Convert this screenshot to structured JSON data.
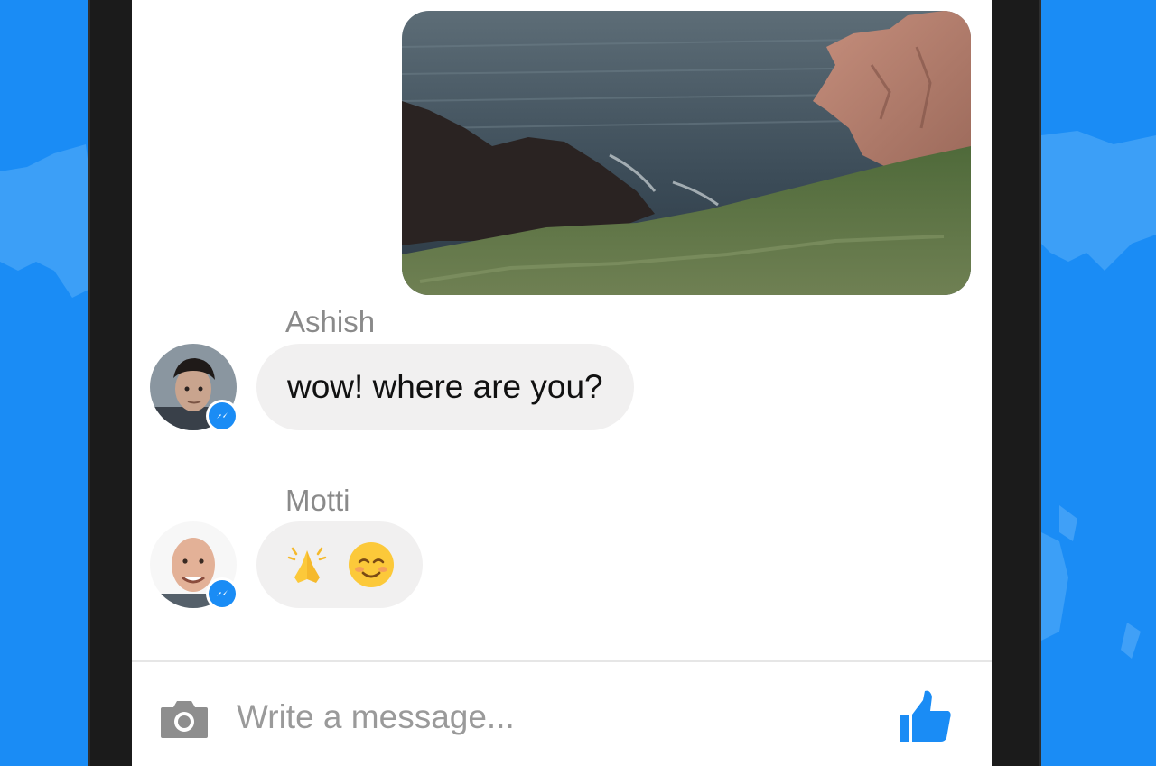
{
  "conversation": {
    "photo_message": {
      "image": "sea-cliff-coast-photo"
    },
    "messages": [
      {
        "sender": "Ashish",
        "text": "wow! where are you?",
        "avatar": "ashish-avatar",
        "badge": "messenger-icon"
      },
      {
        "sender": "Motti",
        "emojis": [
          "folded-hands-emoji",
          "smiling-face-emoji"
        ],
        "avatar": "motti-avatar",
        "badge": "messenger-icon"
      }
    ]
  },
  "composer": {
    "placeholder": "Write a message...",
    "camera_icon": "camera-icon",
    "like_icon": "thumbs-up-icon"
  },
  "colors": {
    "accent": "#1a8cf5",
    "bubble": "#f1f0f0",
    "name_gray": "#8a8a8a",
    "icon_gray": "#8e8e8e",
    "emoji_yellow": "#fcc93a"
  }
}
